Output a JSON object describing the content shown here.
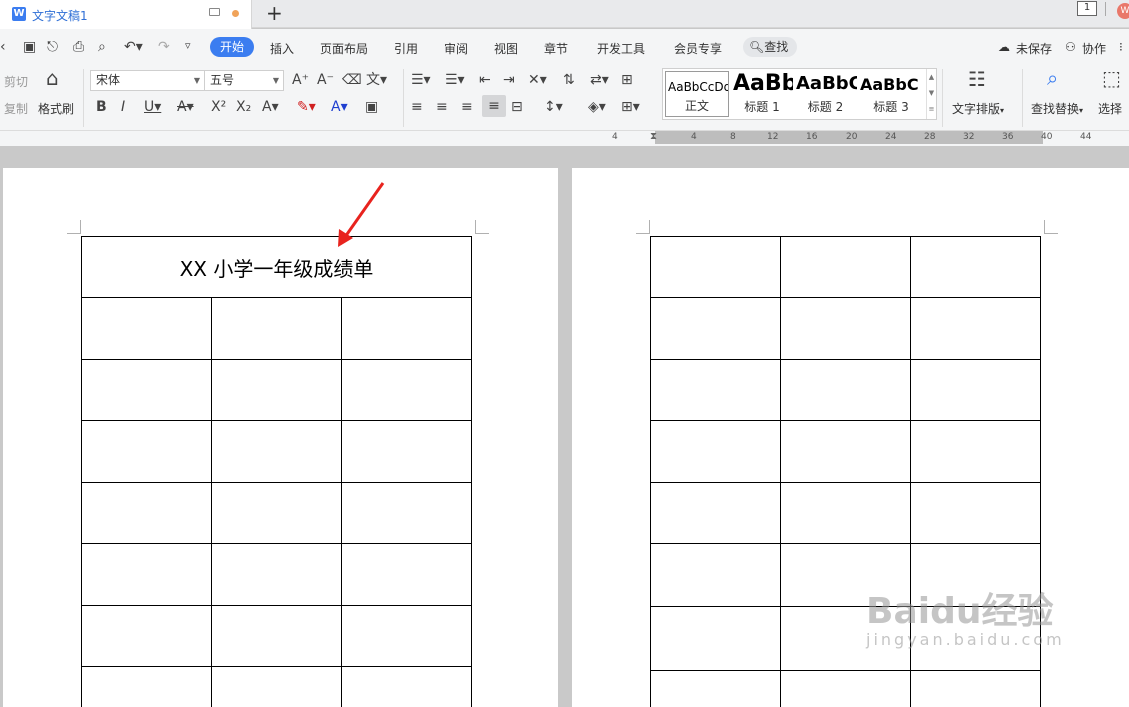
{
  "titlebar": {
    "doc_icon": "W",
    "doc_title": "文字文稿1",
    "new_tab": "+",
    "badge": "1",
    "avatar": "W"
  },
  "menu": {
    "items": [
      "开始",
      "插入",
      "页面布局",
      "引用",
      "审阅",
      "视图",
      "章节",
      "开发工具",
      "会员专享"
    ],
    "find": "查找",
    "unsaved": "未保存",
    "collab": "协作"
  },
  "ribbon": {
    "cut": "剪切",
    "copy": "复制",
    "format_painter": "格式刷",
    "font_name": "宋体",
    "font_size": "五号",
    "styles": [
      {
        "preview": "AaBbCcDd",
        "name": "正文"
      },
      {
        "preview": "AaBb",
        "name": "标题 1"
      },
      {
        "preview": "AaBbC",
        "name": "标题 2"
      },
      {
        "preview": "AaBbC",
        "name": "标题 3"
      }
    ],
    "text_layout": "文字排版",
    "find_replace": "查找替换",
    "select": "选择"
  },
  "ruler": {
    "numbers": [
      "4",
      "4",
      "8",
      "12",
      "16",
      "20",
      "24",
      "28",
      "32",
      "36",
      "40",
      "44"
    ]
  },
  "document": {
    "table_title": "XX 小学一年级成绩单"
  },
  "watermark": {
    "logo": "Baidu经验",
    "sub": "jingyan.baidu.com"
  },
  "colors": {
    "accent": "#3b7df0",
    "doc_title": "#2f6fd6",
    "arrow": "#e8231e"
  }
}
